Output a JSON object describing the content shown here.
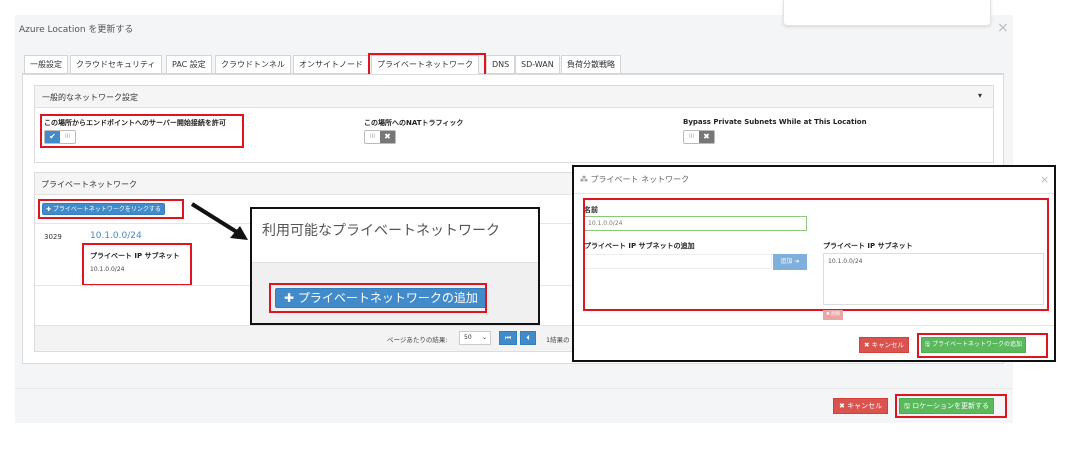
{
  "modal": {
    "title": "Azure Location を更新する",
    "close": "×"
  },
  "tabs": [
    {
      "label": "一般設定"
    },
    {
      "label": "クラウドセキュリティ"
    },
    {
      "label": "PAC 設定"
    },
    {
      "label": "クラウドトンネル"
    },
    {
      "label": "オンサイトノード"
    },
    {
      "label": "プライベートネットワーク"
    },
    {
      "label": "DNS"
    },
    {
      "label": "SD-WAN"
    },
    {
      "label": "負荷分散戦略"
    }
  ],
  "general_network": {
    "header": "一般的なネットワーク設定",
    "caret": "▾",
    "opt1_label": "この場所からエンドポイントへのサーバー開始接続を許可",
    "opt2_label": "この場所へのNATトラフィック",
    "opt3_label": "Bypass Private Subnets While at This Location",
    "toggle_on": "✔",
    "toggle_off": "III",
    "toggle_x": "✖"
  },
  "private_network": {
    "header": "プライベートネットワーク",
    "link_button": "✚ プライベートネットワークをリンクする",
    "row_id": "3029",
    "row_link": "10.1.0.0/24",
    "row_subnet_label": "プライベート IP サブネット",
    "row_subnet_value": "10.1.0.0/24",
    "per_page_label": "ページあたりの結果:",
    "per_page_value": "50",
    "per_page_caret": "⌄",
    "first_icon": "⏮",
    "prev_icon": "⏴",
    "result_text": "1結果の"
  },
  "zoom": {
    "title": "利用可能なプライベートネットワーク",
    "add_button": "✚ プライベートネットワークの追加"
  },
  "dialog": {
    "title_icon": "⁂",
    "title": "プライベート ネットワーク",
    "close": "×",
    "name_label": "名前",
    "name_value": "10.1.0.0/24",
    "subnet_add_label": "プライベート IP サブネットの追加",
    "add_button": "追加 ➔",
    "subnet_list_label": "プライベート IP サブネット",
    "subnet_list_value": "10.1.0.0/24",
    "delete_button": "✖ 削除",
    "cancel_button": "✖ キャンセル",
    "save_button": "🖫 プライベートネットワークの追加"
  },
  "footer": {
    "cancel_button": "✖ キャンセル",
    "save_button": "🖫 ロケーションを更新する"
  },
  "colors": {
    "highlight": "#e0141e",
    "primary": "#428bca",
    "success": "#5cb85c",
    "danger": "#d9534f"
  }
}
